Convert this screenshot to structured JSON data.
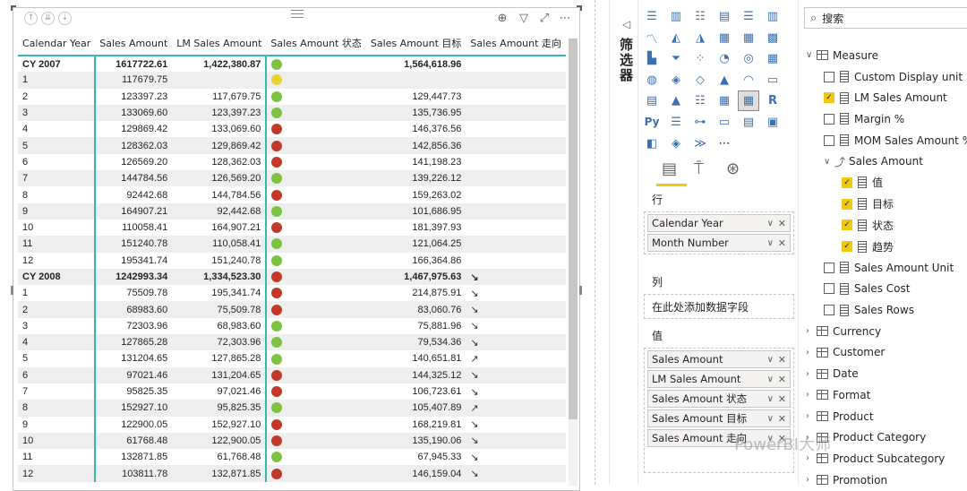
{
  "matrix": {
    "columns": [
      "Calendar Year",
      "Sales Amount",
      "LM Sales Amount",
      "Sales Amount 状态",
      "Sales Amount 目标",
      "Sales Amount 走向"
    ],
    "rows": [
      {
        "label": "CY 2007",
        "sales": "1617722.61",
        "lm": "1,422,380.87",
        "status": "green",
        "target": "1,564,618.96",
        "trend": "",
        "group": true
      },
      {
        "label": "1",
        "sales": "117679.75",
        "lm": "",
        "status": "yellow",
        "target": "",
        "trend": ""
      },
      {
        "label": "2",
        "sales": "123397.23",
        "lm": "117,679.75",
        "status": "green",
        "target": "129,447.73",
        "trend": ""
      },
      {
        "label": "3",
        "sales": "133069.60",
        "lm": "123,397.23",
        "status": "green",
        "target": "135,736.95",
        "trend": ""
      },
      {
        "label": "4",
        "sales": "129869.42",
        "lm": "133,069.60",
        "status": "red",
        "target": "146,376.56",
        "trend": ""
      },
      {
        "label": "5",
        "sales": "128362.03",
        "lm": "129,869.42",
        "status": "red",
        "target": "142,856.36",
        "trend": ""
      },
      {
        "label": "6",
        "sales": "126569.20",
        "lm": "128,362.03",
        "status": "red",
        "target": "141,198.23",
        "trend": ""
      },
      {
        "label": "7",
        "sales": "144784.56",
        "lm": "126,569.20",
        "status": "green",
        "target": "139,226.12",
        "trend": ""
      },
      {
        "label": "8",
        "sales": "92442.68",
        "lm": "144,784.56",
        "status": "red",
        "target": "159,263.02",
        "trend": ""
      },
      {
        "label": "9",
        "sales": "164907.21",
        "lm": "92,442.68",
        "status": "green",
        "target": "101,686.95",
        "trend": ""
      },
      {
        "label": "10",
        "sales": "110058.41",
        "lm": "164,907.21",
        "status": "red",
        "target": "181,397.93",
        "trend": ""
      },
      {
        "label": "11",
        "sales": "151240.78",
        "lm": "110,058.41",
        "status": "green",
        "target": "121,064.25",
        "trend": ""
      },
      {
        "label": "12",
        "sales": "195341.74",
        "lm": "151,240.78",
        "status": "green",
        "target": "166,364.86",
        "trend": ""
      },
      {
        "label": "CY 2008",
        "sales": "1242993.34",
        "lm": "1,334,523.30",
        "status": "red",
        "target": "1,467,975.63",
        "trend": "↘",
        "group": true
      },
      {
        "label": "1",
        "sales": "75509.78",
        "lm": "195,341.74",
        "status": "red",
        "target": "214,875.91",
        "trend": "↘"
      },
      {
        "label": "2",
        "sales": "68983.60",
        "lm": "75,509.78",
        "status": "red",
        "target": "83,060.76",
        "trend": "↘"
      },
      {
        "label": "3",
        "sales": "72303.96",
        "lm": "68,983.60",
        "status": "green",
        "target": "75,881.96",
        "trend": "↘"
      },
      {
        "label": "4",
        "sales": "127865.28",
        "lm": "72,303.96",
        "status": "green",
        "target": "79,534.36",
        "trend": "↘"
      },
      {
        "label": "5",
        "sales": "131204.65",
        "lm": "127,865.28",
        "status": "green",
        "target": "140,651.81",
        "trend": "↗"
      },
      {
        "label": "6",
        "sales": "97021.46",
        "lm": "131,204.65",
        "status": "red",
        "target": "144,325.12",
        "trend": "↘"
      },
      {
        "label": "7",
        "sales": "95825.35",
        "lm": "97,021.46",
        "status": "red",
        "target": "106,723.61",
        "trend": "↘"
      },
      {
        "label": "8",
        "sales": "152927.10",
        "lm": "95,825.35",
        "status": "green",
        "target": "105,407.89",
        "trend": "↗"
      },
      {
        "label": "9",
        "sales": "122900.05",
        "lm": "152,927.10",
        "status": "red",
        "target": "168,219.81",
        "trend": "↘"
      },
      {
        "label": "10",
        "sales": "61768.48",
        "lm": "122,900.05",
        "status": "red",
        "target": "135,190.06",
        "trend": "↘"
      },
      {
        "label": "11",
        "sales": "132871.85",
        "lm": "61,768.48",
        "status": "green",
        "target": "67,945.33",
        "trend": "↘"
      },
      {
        "label": "12",
        "sales": "103811.78",
        "lm": "132,871.85",
        "status": "red",
        "target": "146,159.04",
        "trend": "↘"
      }
    ]
  },
  "status_colors": {
    "green": "#7dc242",
    "yellow": "#e8d234",
    "red": "#c0392b"
  },
  "filters_pane": {
    "label": "筛选器"
  },
  "viz_pane": {
    "rows_label": "行",
    "row_fields": [
      "Calendar Year",
      "Month Number"
    ],
    "columns_label": "列",
    "columns_placeholder": "在此处添加数据字段",
    "values_label": "值",
    "value_fields": [
      "Sales Amount",
      "LM Sales Amount",
      "Sales Amount 状态",
      "Sales Amount 目标",
      "Sales Amount 走向"
    ]
  },
  "fields_pane": {
    "search_placeholder": "搜索",
    "items": [
      {
        "kind": "table",
        "label": "Measure",
        "level": 0,
        "expanded": true
      },
      {
        "kind": "measure",
        "label": "Custom Display unit",
        "level": 1,
        "checked": false
      },
      {
        "kind": "measure",
        "label": "LM Sales Amount",
        "level": 1,
        "checked": true
      },
      {
        "kind": "measure",
        "label": "Margin %",
        "level": 1,
        "checked": false
      },
      {
        "kind": "measure",
        "label": "MOM Sales Amount %",
        "level": 1,
        "checked": false
      },
      {
        "kind": "kpi",
        "label": "Sales Amount",
        "level": 1,
        "expanded": true
      },
      {
        "kind": "measure",
        "label": "值",
        "level": 2,
        "checked": true
      },
      {
        "kind": "measure",
        "label": "目标",
        "level": 2,
        "checked": true
      },
      {
        "kind": "measure",
        "label": "状态",
        "level": 2,
        "checked": true
      },
      {
        "kind": "measure",
        "label": "趋势",
        "level": 2,
        "checked": true
      },
      {
        "kind": "measure",
        "label": "Sales Amount Unit",
        "level": 1,
        "checked": false
      },
      {
        "kind": "measure",
        "label": "Sales Cost",
        "level": 1,
        "checked": false
      },
      {
        "kind": "measure",
        "label": "Sales Rows",
        "level": 1,
        "checked": false
      },
      {
        "kind": "table",
        "label": "Currency",
        "level": 0,
        "expanded": false
      },
      {
        "kind": "table",
        "label": "Customer",
        "level": 0,
        "expanded": false
      },
      {
        "kind": "table",
        "label": "Date",
        "level": 0,
        "expanded": false
      },
      {
        "kind": "table",
        "label": "Format",
        "level": 0,
        "expanded": false
      },
      {
        "kind": "table",
        "label": "Product",
        "level": 0,
        "expanded": false
      },
      {
        "kind": "table",
        "label": "Product Category",
        "level": 0,
        "expanded": false
      },
      {
        "kind": "table",
        "label": "Product Subcategory",
        "level": 0,
        "expanded": false
      },
      {
        "kind": "table",
        "label": "Promotion",
        "level": 0,
        "expanded": false
      }
    ]
  },
  "watermark": "PowerBI大师"
}
